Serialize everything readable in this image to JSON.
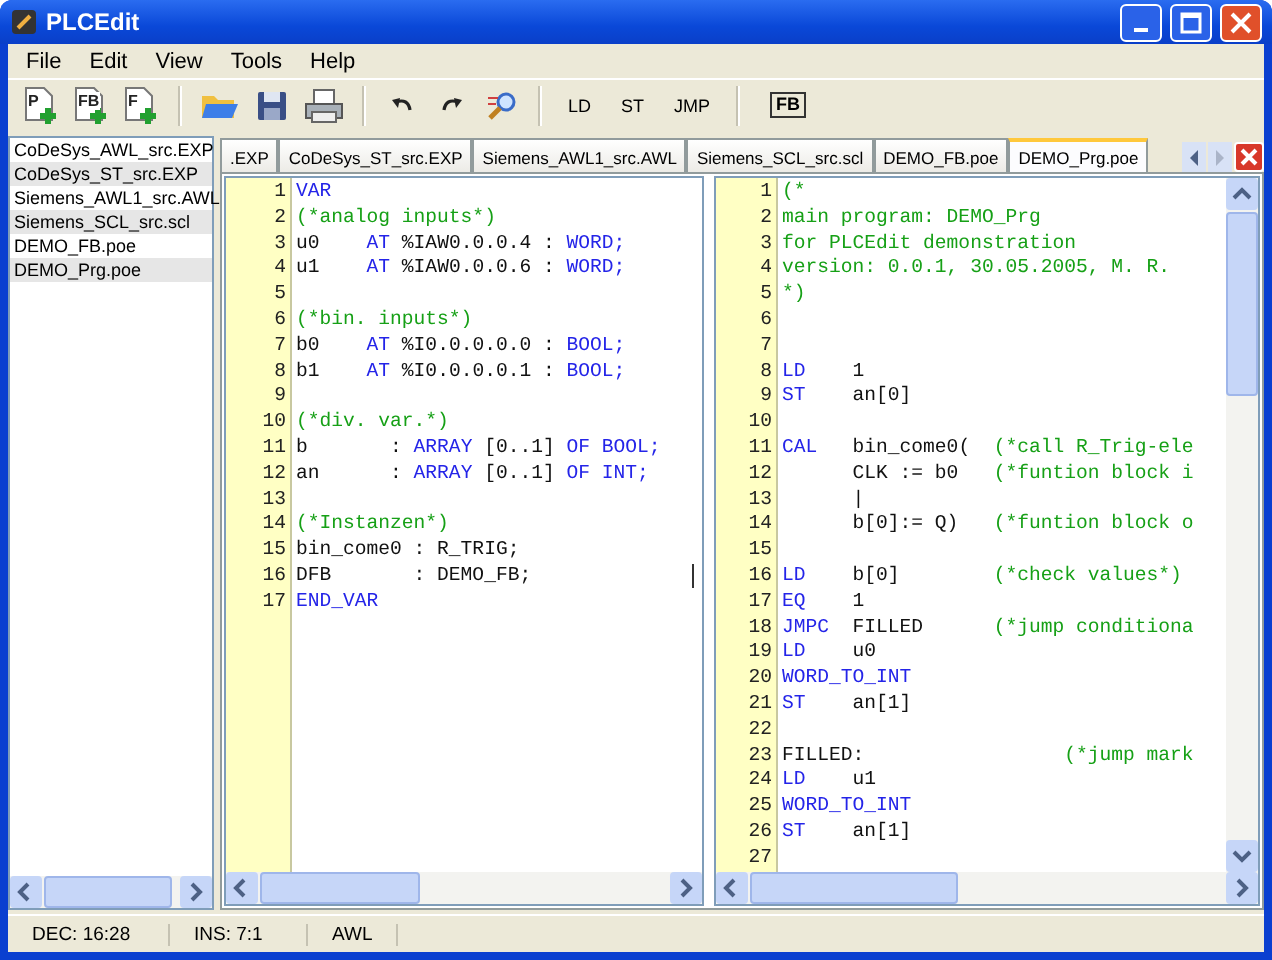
{
  "window": {
    "title": "PLCEdit"
  },
  "menu": [
    "File",
    "Edit",
    "View",
    "Tools",
    "Help"
  ],
  "toolbar": [
    {
      "kind": "new",
      "label": "P"
    },
    {
      "kind": "new",
      "label": "FB"
    },
    {
      "kind": "new",
      "label": "F"
    },
    {
      "kind": "separator"
    },
    {
      "kind": "open"
    },
    {
      "kind": "save"
    },
    {
      "kind": "print"
    },
    {
      "kind": "separator"
    },
    {
      "kind": "undo"
    },
    {
      "kind": "redo"
    },
    {
      "kind": "find"
    },
    {
      "kind": "separator"
    },
    {
      "kind": "text",
      "label": "LD"
    },
    {
      "kind": "text",
      "label": "ST"
    },
    {
      "kind": "text",
      "label": "JMP"
    },
    {
      "kind": "separator"
    },
    {
      "kind": "boxed",
      "label": "FB"
    }
  ],
  "files": [
    "CoDeSys_AWL_src.EXP",
    "CoDeSys_ST_src.EXP",
    "Siemens_AWL1_src.AWL",
    "Siemens_SCL_src.scl",
    "DEMO_FB.poe",
    "DEMO_Prg.poe"
  ],
  "tabs": [
    {
      "label": ".EXP",
      "selected": false
    },
    {
      "label": "CoDeSys_ST_src.EXP",
      "selected": false
    },
    {
      "label": "Siemens_AWL1_src.AWL",
      "selected": false
    },
    {
      "label": "Siemens_SCL_src.scl",
      "selected": false
    },
    {
      "label": "DEMO_FB.poe",
      "selected": false
    },
    {
      "label": "DEMO_Prg.poe",
      "selected": true
    }
  ],
  "editors": [
    {
      "lines": [
        {
          "number": "1",
          "segments": [
            {
              "kind": "keyword",
              "text": "VAR"
            }
          ]
        },
        {
          "number": "2",
          "segments": [
            {
              "kind": "comment",
              "text": "(*analog inputs*)"
            }
          ]
        },
        {
          "number": "3",
          "segments": [
            {
              "kind": "plain",
              "text": "u0    "
            },
            {
              "kind": "keyword",
              "text": "AT"
            },
            {
              "kind": "plain",
              "text": " %IAW0.0.0.4 : "
            },
            {
              "kind": "keyword",
              "text": "WORD;"
            }
          ]
        },
        {
          "number": "4",
          "segments": [
            {
              "kind": "plain",
              "text": "u1    "
            },
            {
              "kind": "keyword",
              "text": "AT"
            },
            {
              "kind": "plain",
              "text": " %IAW0.0.0.6 : "
            },
            {
              "kind": "keyword",
              "text": "WORD;"
            }
          ]
        },
        {
          "number": "5"
        },
        {
          "number": "6",
          "segments": [
            {
              "kind": "comment",
              "text": "(*bin. inputs*)"
            }
          ]
        },
        {
          "number": "7",
          "segments": [
            {
              "kind": "plain",
              "text": "b0    "
            },
            {
              "kind": "keyword",
              "text": "AT"
            },
            {
              "kind": "plain",
              "text": " %I0.0.0.0.0 : "
            },
            {
              "kind": "keyword",
              "text": "BOOL;"
            }
          ]
        },
        {
          "number": "8",
          "segments": [
            {
              "kind": "plain",
              "text": "b1    "
            },
            {
              "kind": "keyword",
              "text": "AT"
            },
            {
              "kind": "plain",
              "text": " %I0.0.0.0.1 : "
            },
            {
              "kind": "keyword",
              "text": "BOOL;"
            }
          ]
        },
        {
          "number": "9"
        },
        {
          "number": "10",
          "segments": [
            {
              "kind": "comment",
              "text": "(*div. var.*)"
            }
          ]
        },
        {
          "number": "11",
          "segments": [
            {
              "kind": "plain",
              "text": "b       : "
            },
            {
              "kind": "keyword",
              "text": "ARRAY"
            },
            {
              "kind": "plain",
              "text": " [0..1] "
            },
            {
              "kind": "keyword",
              "text": "OF BOOL;"
            }
          ]
        },
        {
          "number": "12",
          "segments": [
            {
              "kind": "plain",
              "text": "an      : "
            },
            {
              "kind": "keyword",
              "text": "ARRAY"
            },
            {
              "kind": "plain",
              "text": " [0..1] "
            },
            {
              "kind": "keyword",
              "text": "OF INT;"
            }
          ]
        },
        {
          "number": "13"
        },
        {
          "number": "14",
          "segments": [
            {
              "kind": "comment",
              "text": "(*Instanzen*)"
            }
          ]
        },
        {
          "number": "15",
          "segments": [
            {
              "kind": "plain",
              "text": "bin_come0 : R_TRIG;"
            }
          ]
        },
        {
          "number": "16",
          "segments": [
            {
              "kind": "plain",
              "text": "DFB       : DEMO_FB;"
            }
          ],
          "cursor": true
        },
        {
          "number": "17",
          "segments": [
            {
              "kind": "keyword",
              "text": "END_VAR"
            }
          ]
        }
      ],
      "vertical_scrollbar": false
    },
    {
      "lines": [
        {
          "number": "1",
          "segments": [
            {
              "kind": "comment",
              "text": "(*"
            }
          ]
        },
        {
          "number": "2",
          "segments": [
            {
              "kind": "comment",
              "text": "main program: DEMO_Prg"
            }
          ]
        },
        {
          "number": "3",
          "segments": [
            {
              "kind": "comment",
              "text": "for PLCEdit demonstration"
            }
          ]
        },
        {
          "number": "4",
          "segments": [
            {
              "kind": "comment",
              "text": "version: 0.0.1, 30.05.2005, M. R."
            }
          ]
        },
        {
          "number": "5",
          "segments": [
            {
              "kind": "comment",
              "text": "*)"
            }
          ]
        },
        {
          "number": "6"
        },
        {
          "number": "7"
        },
        {
          "number": "8",
          "segments": [
            {
              "kind": "keyword",
              "text": "LD"
            },
            {
              "kind": "plain",
              "text": "    1"
            }
          ]
        },
        {
          "number": "9",
          "segments": [
            {
              "kind": "keyword",
              "text": "ST"
            },
            {
              "kind": "plain",
              "text": "    an[0]"
            }
          ]
        },
        {
          "number": "10"
        },
        {
          "number": "11",
          "segments": [
            {
              "kind": "keyword",
              "text": "CAL"
            },
            {
              "kind": "plain",
              "text": "   bin_come0(  "
            },
            {
              "kind": "comment",
              "text": "(*call R_Trig-ele"
            }
          ]
        },
        {
          "number": "12",
          "segments": [
            {
              "kind": "plain",
              "text": "      CLK := b0   "
            },
            {
              "kind": "comment",
              "text": "(*funtion block i"
            }
          ]
        },
        {
          "number": "13",
          "segments": [
            {
              "kind": "plain",
              "text": "      |"
            }
          ]
        },
        {
          "number": "14",
          "segments": [
            {
              "kind": "plain",
              "text": "      b[0]:= Q)   "
            },
            {
              "kind": "comment",
              "text": "(*funtion block o"
            }
          ]
        },
        {
          "number": "15"
        },
        {
          "number": "16",
          "segments": [
            {
              "kind": "keyword",
              "text": "LD"
            },
            {
              "kind": "plain",
              "text": "    b[0]        "
            },
            {
              "kind": "comment",
              "text": "(*check values*)"
            }
          ]
        },
        {
          "number": "17",
          "segments": [
            {
              "kind": "keyword",
              "text": "EQ"
            },
            {
              "kind": "plain",
              "text": "    1"
            }
          ]
        },
        {
          "number": "18",
          "segments": [
            {
              "kind": "keyword",
              "text": "JMPC"
            },
            {
              "kind": "plain",
              "text": "  FILLED      "
            },
            {
              "kind": "comment",
              "text": "(*jump conditiona"
            }
          ]
        },
        {
          "number": "19",
          "segments": [
            {
              "kind": "keyword",
              "text": "LD"
            },
            {
              "kind": "plain",
              "text": "    u0"
            }
          ]
        },
        {
          "number": "20",
          "segments": [
            {
              "kind": "keyword",
              "text": "WORD_TO_INT"
            }
          ]
        },
        {
          "number": "21",
          "segments": [
            {
              "kind": "keyword",
              "text": "ST"
            },
            {
              "kind": "plain",
              "text": "    an[1]"
            }
          ]
        },
        {
          "number": "22"
        },
        {
          "number": "23",
          "segments": [
            {
              "kind": "plain",
              "text": "FILLED:                 "
            },
            {
              "kind": "comment",
              "text": "(*jump mark"
            }
          ]
        },
        {
          "number": "24",
          "segments": [
            {
              "kind": "keyword",
              "text": "LD"
            },
            {
              "kind": "plain",
              "text": "    u1"
            }
          ]
        },
        {
          "number": "25",
          "segments": [
            {
              "kind": "keyword",
              "text": "WORD_TO_INT"
            }
          ]
        },
        {
          "number": "26",
          "segments": [
            {
              "kind": "keyword",
              "text": "ST"
            },
            {
              "kind": "plain",
              "text": "    an[1]"
            }
          ]
        },
        {
          "number": "27"
        }
      ],
      "vertical_scrollbar": true
    }
  ],
  "status_bar": [
    "DEC: 16:28",
    "INS: 7:1",
    "AWL"
  ]
}
